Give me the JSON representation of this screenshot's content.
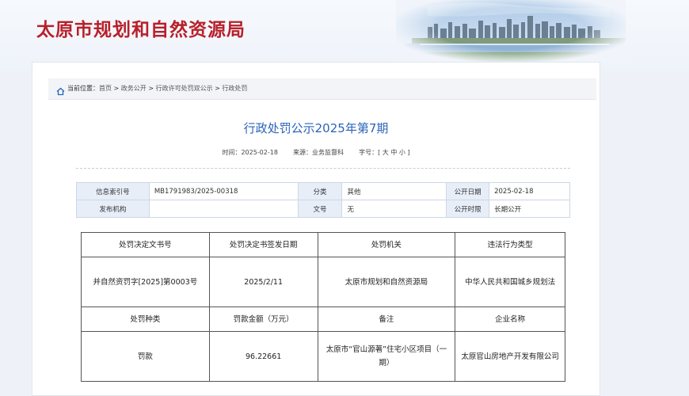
{
  "site": {
    "title": "太原市规划和自然资源局"
  },
  "breadcrumb": {
    "label": "当前位置：",
    "items": [
      "首页",
      "政务公开",
      "行政许可处罚双公示",
      "行政处罚"
    ],
    "separator": " > "
  },
  "article": {
    "title": "行政处罚公示2025年第7期",
    "time_label": "时间：",
    "time_value": "2025-02-18",
    "source_label": "来源：",
    "source_value": "业务监督科",
    "fontsize_label": "字号：",
    "fontsize_options": "[ 大 中 小 ]"
  },
  "info_table": {
    "index_label": "信息索引号",
    "index_value": "MB1791983/2025-00318",
    "category_label": "分类",
    "category_value": "其他",
    "date_label": "公开日期",
    "date_value": "2025-02-18",
    "org_label": "发布机构",
    "org_value": "",
    "doc_label": "文号",
    "doc_value": "无",
    "period_label": "公开时限",
    "period_value": "长期公开"
  },
  "penalty_table": {
    "headers1": [
      "处罚决定文书号",
      "处罚决定书签发日期",
      "处罚机关",
      "违法行为类型"
    ],
    "row1": [
      "并自然资罚字[2025]第0003号",
      "2025/2/11",
      "太原市规划和自然资源局",
      "中华人民共和国城乡规划法"
    ],
    "headers2": [
      "处罚种类",
      "罚款金额（万元）",
      "备注",
      "企业名称"
    ],
    "row2": [
      "罚款",
      "96.22661",
      "太原市“官山源著”住宅小区项目（一期）",
      "太原官山房地产开发有限公司"
    ]
  },
  "colors": {
    "brand_red": "#b8202a",
    "title_blue": "#2a63b8"
  },
  "icons": {
    "home": "home-icon"
  }
}
